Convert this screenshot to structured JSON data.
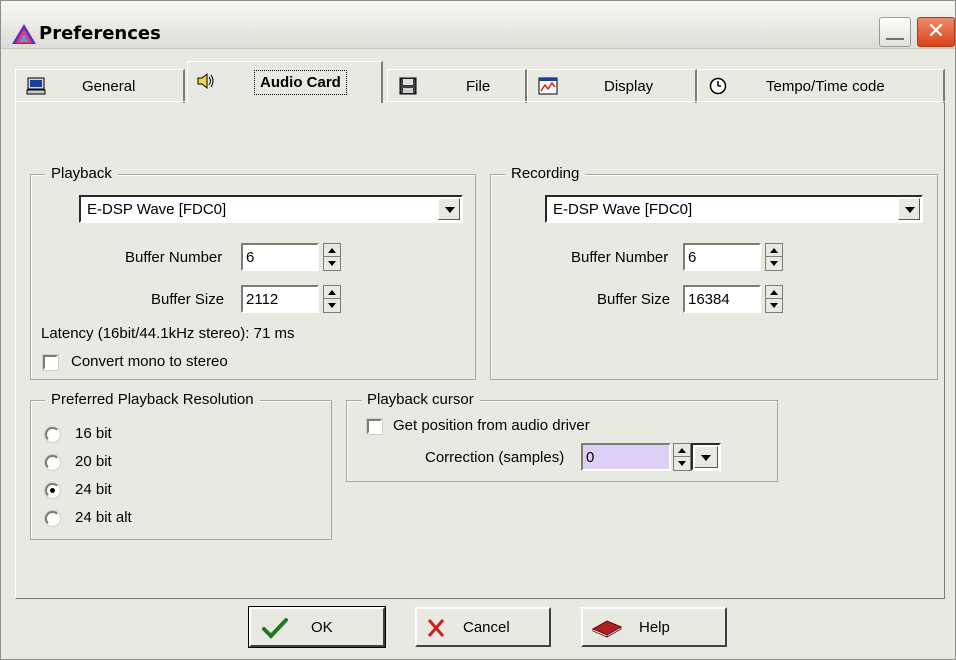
{
  "window": {
    "title": "Preferences",
    "icons": {
      "app": "triangle-logo-icon",
      "minimize": "minimize-icon",
      "close": "close-icon"
    },
    "close_glyph": "✕"
  },
  "tabs": [
    {
      "label": "General",
      "icon": "computer-icon",
      "active": false
    },
    {
      "label": "Audio Card",
      "icon": "speaker-icon",
      "active": true
    },
    {
      "label": "File",
      "icon": "floppy-disk-icon",
      "active": false
    },
    {
      "label": "Display",
      "icon": "display-chart-icon",
      "active": false
    },
    {
      "label": "Tempo/Time code",
      "icon": "clock-icon",
      "active": false
    }
  ],
  "playback": {
    "title": "Playback",
    "device": "E-DSP Wave [FDC0]",
    "buffer_number_label": "Buffer Number",
    "buffer_number": "6",
    "buffer_size_label": "Buffer Size",
    "buffer_size": "2112",
    "latency": "Latency (16bit/44.1kHz stereo): 71 ms",
    "convert_mono_label": "Convert mono to stereo",
    "convert_mono_checked": false
  },
  "recording": {
    "title": "Recording",
    "device": "E-DSP Wave [FDC0]",
    "buffer_number_label": "Buffer Number",
    "buffer_number": "6",
    "buffer_size_label": "Buffer Size",
    "buffer_size": "16384"
  },
  "resolution": {
    "title": "Preferred Playback Resolution",
    "options": [
      {
        "label": "16 bit",
        "checked": false
      },
      {
        "label": "20 bit",
        "checked": false
      },
      {
        "label": "24 bit",
        "checked": true
      },
      {
        "label": "24 bit alt",
        "checked": false
      }
    ]
  },
  "cursor": {
    "title": "Playback cursor",
    "get_position_label": "Get position from audio driver",
    "get_position_checked": false,
    "correction_label": "Correction (samples)",
    "correction_value": "0",
    "correction_bg": "#dcd0f6"
  },
  "buttons": {
    "ok": "OK",
    "cancel": "Cancel",
    "help": "Help"
  },
  "colors": {
    "window_bg": "#e9e9e4",
    "ok_check": "#1f7a1f",
    "cancel_x": "#cc2020",
    "help_book": "#b02020"
  }
}
